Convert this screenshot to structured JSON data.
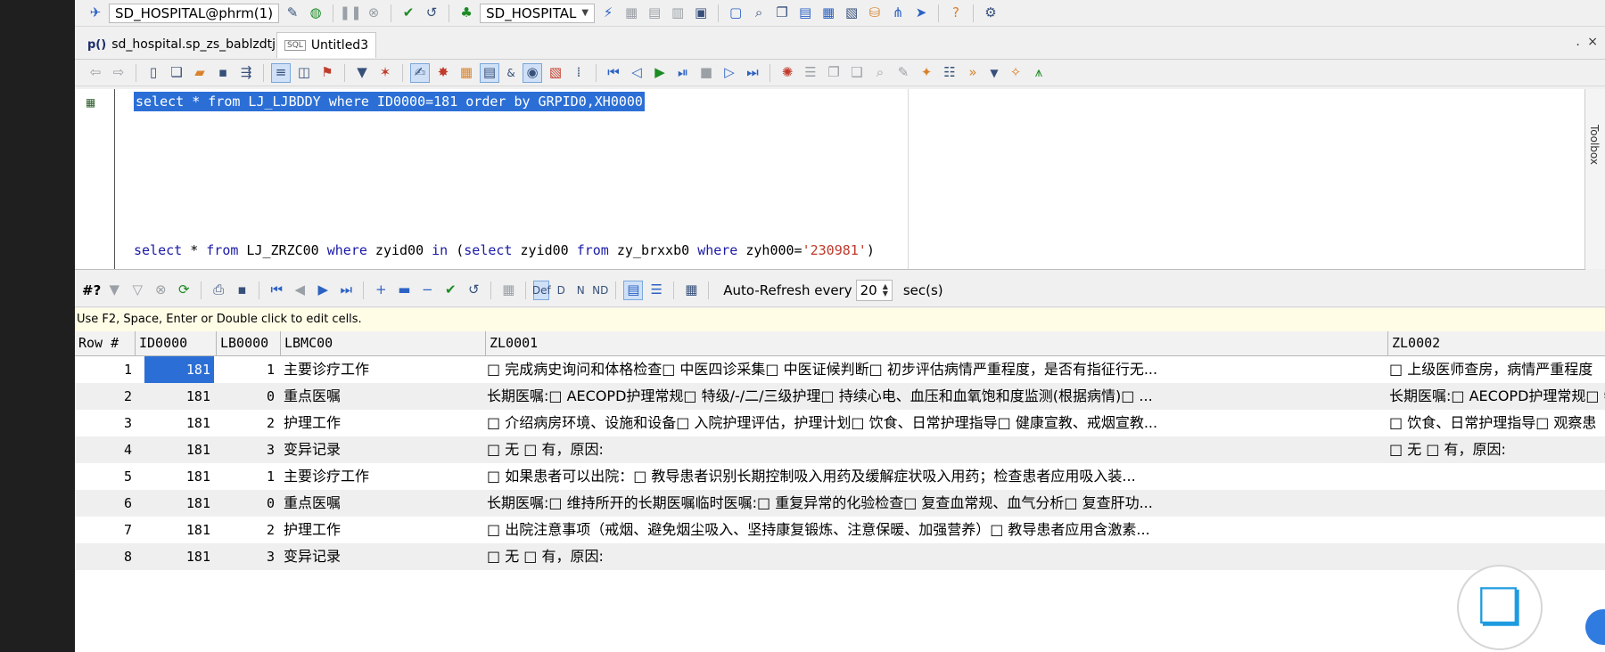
{
  "top_toolbar": {
    "connection_label": "SD_HOSPITAL@phrm(1)",
    "schema_label": "SD_HOSPITAL"
  },
  "tabs": [
    {
      "tag": "p()",
      "label": "sd_hospital.sp_zs_bablzdtj"
    },
    {
      "tag": "SQL",
      "label": "Untitled3"
    }
  ],
  "tabs_more": ". ×",
  "editor": {
    "line1": {
      "kw1": "select",
      "rest1": " * ",
      "kw2": "from",
      "rest2": " LJ_LJBDDY ",
      "kw3": "where",
      "rest3": " ID0000=181 ",
      "kw4": "order by",
      "rest4": " GRPID0,XH0000"
    },
    "line2": {
      "kw1": "select",
      "rest1": " * ",
      "kw2": "from",
      "rest2": " LJ_ZRZC00 ",
      "kw3": "where",
      "rest3": " zyid00 ",
      "kw4": "in",
      "rest4": " (",
      "kw5": "select",
      "rest5": " zyid00 ",
      "kw6": "from",
      "rest6": " zy_brxxb0 ",
      "kw7": "where",
      "rest7": " zyh000=",
      "str": "'230981'",
      "rest8": ")"
    }
  },
  "side_panel": {
    "label": "Toolbox"
  },
  "grid_toolbar": {
    "hash_label": "#?",
    "auto_refresh_label": "Auto-Refresh every",
    "refresh_value": "20",
    "unit_label": "sec(s)"
  },
  "hint": "Use F2, Space, Enter or Double click to edit cells.",
  "grid": {
    "columns": [
      "Row #",
      "ID0000",
      "LB0000",
      "LBMC00",
      "ZL0001",
      "ZL0002"
    ],
    "rows": [
      {
        "row": "1",
        "id": "181",
        "lb": "1",
        "mc": "主要诊疗工作",
        "zl1": "□ 完成病史询问和体格检查□ 中医四诊采集□ 中医证候判断□ 初步评估病情严重程度，是否有指征行无...",
        "zl2": "□ 上级医师查房，病情严重程度"
      },
      {
        "row": "2",
        "id": "181",
        "lb": "0",
        "mc": "重点医嘱",
        "zl1": "长期医嘱:□ AECOPD护理常规□ 特级/-/二/三级护理□ 持续心电、血压和血氧饱和度监测(根据病情)□ ...",
        "zl2": "长期医嘱:□ AECOPD护理常规□ 特"
      },
      {
        "row": "3",
        "id": "181",
        "lb": "2",
        "mc": "护理工作",
        "zl1": "□ 介绍病房环境、设施和设备□ 入院护理评估，护理计划□ 饮食、日常护理指导□ 健康宣教、戒烟宣教...",
        "zl2": "□ 饮食、日常护理指导□ 观察患"
      },
      {
        "row": "4",
        "id": "181",
        "lb": "3",
        "mc": "变异记录",
        "zl1": "□ 无 □ 有，原因:",
        "zl2": "□ 无 □ 有，原因:"
      },
      {
        "row": "5",
        "id": "181",
        "lb": "1",
        "mc": "主要诊疗工作",
        "zl1": "□ 如果患者可以出院：□    教导患者识别长期控制吸入用药及缓解症状吸入用药；检查患者应用吸入装...",
        "zl2": ""
      },
      {
        "row": "6",
        "id": "181",
        "lb": "0",
        "mc": "重点医嘱",
        "zl1": "长期医嘱:□ 维持所开的长期医嘱临时医嘱:□ 重复异常的化验检查□ 复查血常规、血气分析□ 复查肝功...",
        "zl2": ""
      },
      {
        "row": "7",
        "id": "181",
        "lb": "2",
        "mc": "护理工作",
        "zl1": "□ 出院注意事项（戒烟、避免烟尘吸入、坚持康复锻炼、注意保暖、加强营养）□ 教导患者应用含激素...",
        "zl2": ""
      },
      {
        "row": "8",
        "id": "181",
        "lb": "3",
        "mc": "变异记录",
        "zl1": "□ 无 □ 有，原因:",
        "zl2": ""
      }
    ]
  }
}
